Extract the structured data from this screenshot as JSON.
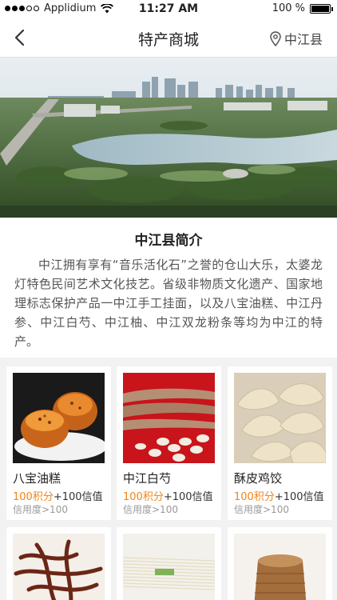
{
  "status_bar": {
    "carrier": "Applidium",
    "time": "11:27 AM",
    "battery": "100 %"
  },
  "nav": {
    "title": "特产商城",
    "location": "中江县"
  },
  "intro": {
    "title": "中江县简介",
    "text": "中江拥有享有“音乐活化石”之誉的仓山大乐，太婆龙灯特色民间艺术文化技艺。省级非物质文化遗产、国家地理标志保护产品一中江手工挂面，以及八宝油糕、中江丹参、中江白芍、中江柚、中江双龙粉条等均为中江的特产。"
  },
  "products": [
    {
      "name": "八宝油糕",
      "points": "100积分",
      "plus": "+100信值",
      "credit": "信用度>100"
    },
    {
      "name": "中江白芍",
      "points": "100积分",
      "plus": "+100信值",
      "credit": "信用度>100"
    },
    {
      "name": "酥皮鸡饺",
      "points": "100积分",
      "plus": "+100信值",
      "credit": "信用度>100"
    }
  ],
  "colors": {
    "accent": "#f08519",
    "background": "#f2f2f2"
  }
}
